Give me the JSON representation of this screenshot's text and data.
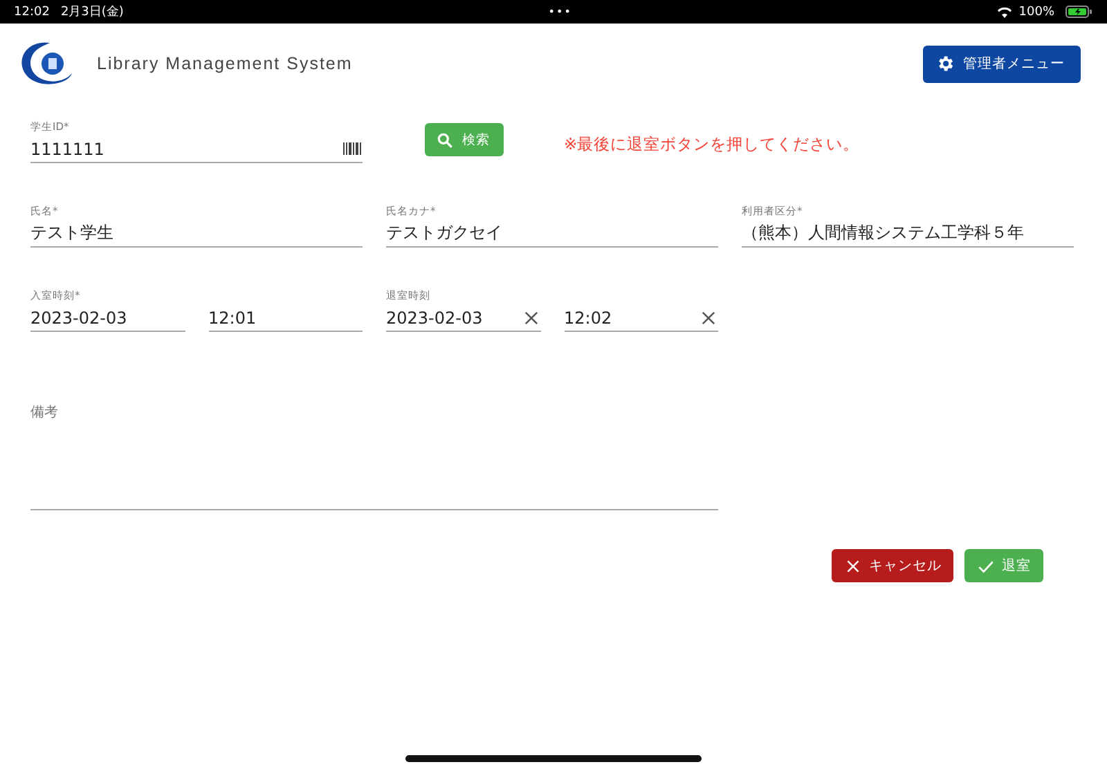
{
  "status_bar": {
    "time": "12:02",
    "date": "2月3日(金)",
    "dots": "•••",
    "battery": "100%"
  },
  "header": {
    "title": "Library Management System",
    "admin_button": "管理者メニュー"
  },
  "student_id": {
    "label": "学生ID*",
    "value": "1111111"
  },
  "search_button": "検索",
  "notice": "※最後に退室ボタンを押してください。",
  "name_fields": [
    {
      "label": "氏名*",
      "value": "テスト学生"
    },
    {
      "label": "氏名カナ*",
      "value": "テストガクセイ"
    },
    {
      "label": "利用者区分*",
      "value": "（熊本）人間情報システム工学科５年"
    }
  ],
  "time_fields": [
    {
      "label": "入室時刻*",
      "value": "2023-02-03",
      "clearable": false
    },
    {
      "value": "12:01",
      "clearable": false
    },
    {
      "label": "退室時刻",
      "value": "2023-02-03",
      "clearable": true
    },
    {
      "value": "12:02",
      "clearable": true
    }
  ],
  "remarks": {
    "label": "備考"
  },
  "buttons": [
    {
      "label": "キャンセル",
      "kind": "cancel"
    },
    {
      "label": "退室",
      "kind": "exit"
    }
  ]
}
